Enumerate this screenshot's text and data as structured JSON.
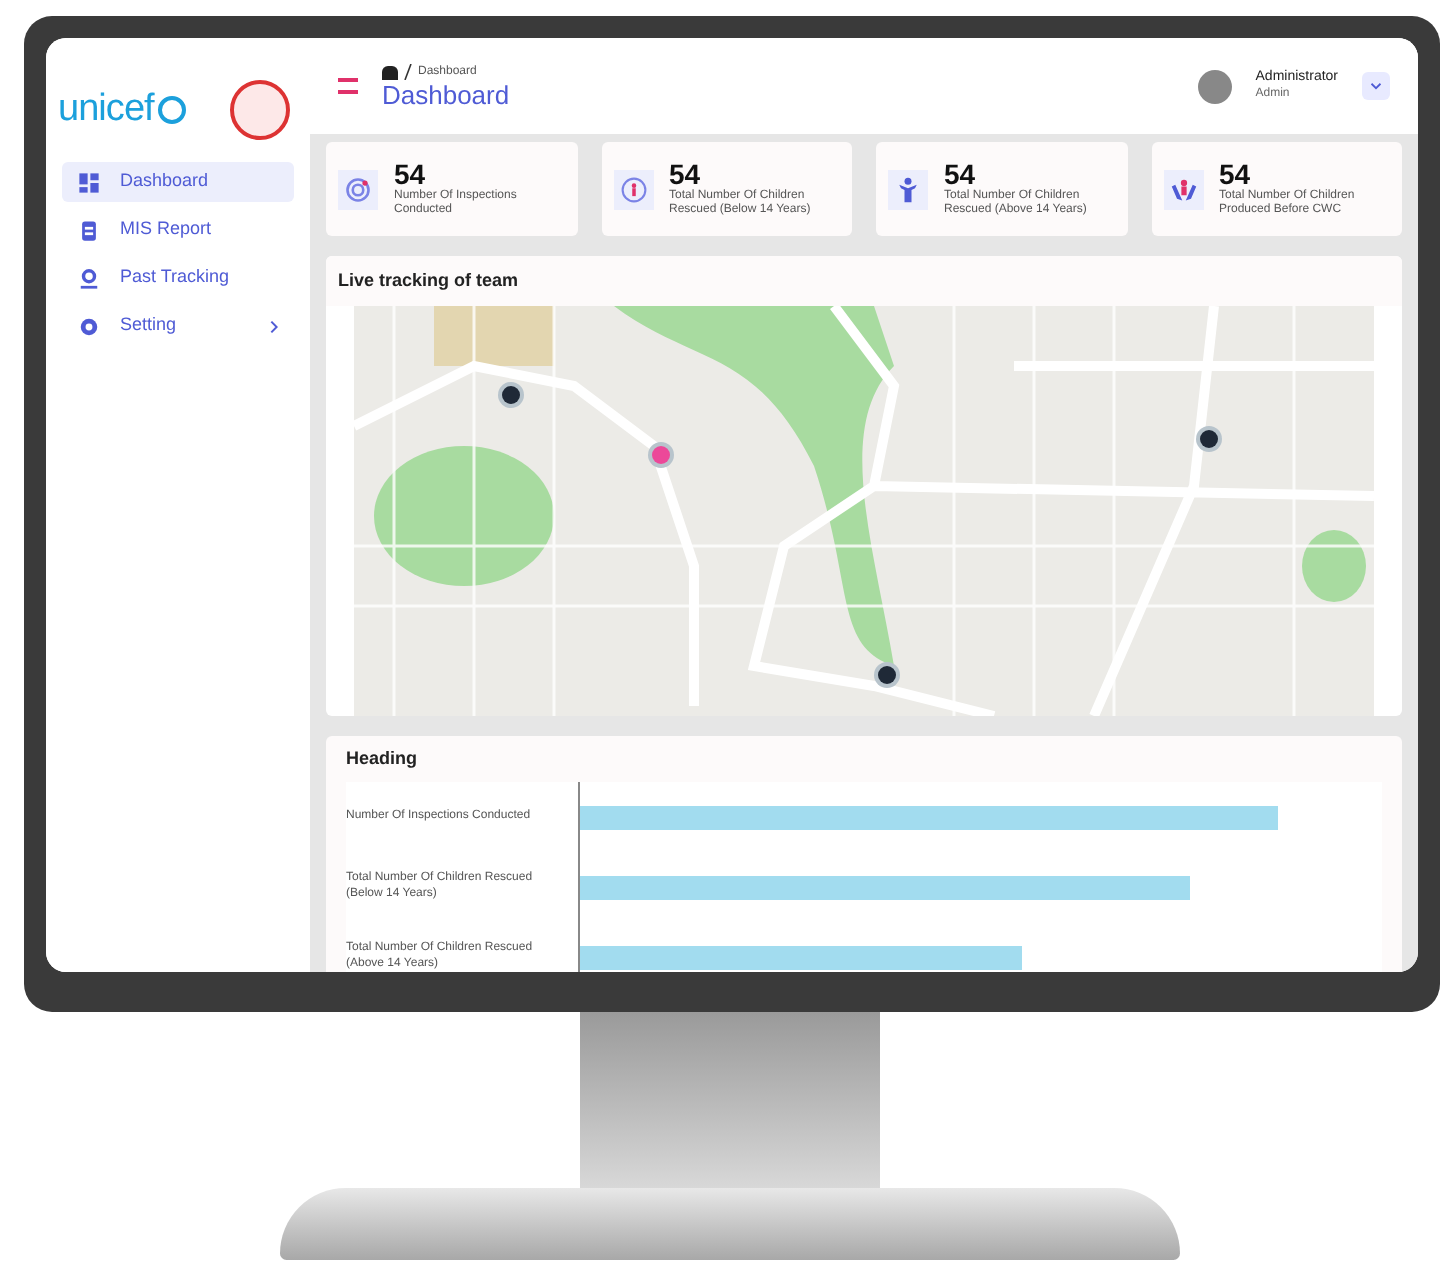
{
  "sidebar": {
    "logo": "unicef",
    "items": [
      {
        "label": "Dashboard",
        "selected": true,
        "kind": "dashboard"
      },
      {
        "label": "MIS Report",
        "selected": false,
        "kind": "report"
      },
      {
        "label": "Past Tracking",
        "selected": false,
        "kind": "tracking"
      },
      {
        "label": "Setting",
        "selected": false,
        "kind": "setting"
      }
    ]
  },
  "header": {
    "breadcrumb": "Dashboard",
    "title": "Dashboard",
    "user": {
      "name": "Administrator",
      "role": "Admin"
    }
  },
  "stats": [
    {
      "value": "54",
      "label": "Number Of Inspections Conducted",
      "kind": "inspections"
    },
    {
      "value": "54",
      "label": "Total Number Of Children Rescued (Below 14 Years)",
      "kind": "below"
    },
    {
      "value": "54",
      "label": "Total Number Of Children Rescued (Above 14 Years)",
      "kind": "above"
    },
    {
      "value": "54",
      "label": "Total Number Of Children Produced Before CWC",
      "kind": "cwc"
    }
  ],
  "map_card": {
    "title": "Live tracking of team",
    "markers": [
      {
        "color": "#1f2937"
      },
      {
        "color": "#ec4899"
      },
      {
        "color": "#1f2937"
      },
      {
        "color": "#1f2937"
      }
    ]
  },
  "chart_card": {
    "title": "Heading",
    "bars": [
      {
        "label": "Number Of Inspections Conducted"
      },
      {
        "label": "Total Number Of Children Rescued (Below 14 Years)"
      },
      {
        "label": "Total Number Of Children Rescued (Above 14 Years)"
      }
    ]
  }
}
